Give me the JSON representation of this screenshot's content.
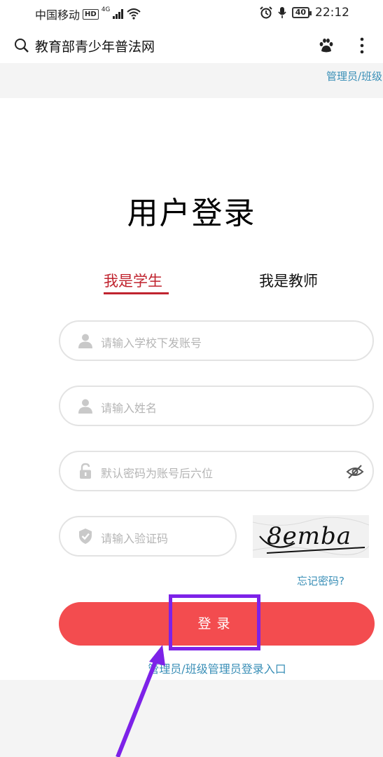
{
  "status_bar": {
    "carrier": "中国移动",
    "hd_badge": "HD",
    "network": "4G",
    "battery": "40",
    "time": "22:12"
  },
  "browser": {
    "title": "教育部青少年普法网"
  },
  "page": {
    "top_link": "管理员/班级",
    "heading": "用户登录",
    "tabs": [
      {
        "label": "我是学生",
        "active": true
      },
      {
        "label": "我是教师",
        "active": false
      }
    ],
    "fields": {
      "account_placeholder": "请输入学校下发账号",
      "name_placeholder": "请输入姓名",
      "password_placeholder": "默认密码为账号后六位",
      "captcha_placeholder": "请输入验证码"
    },
    "captcha_text": "8emba",
    "forgot_password": "忘记密码?",
    "login_button": "登录",
    "admin_entry": "管理员/班级管理员登录入口"
  },
  "colors": {
    "accent_red": "#c0242f",
    "button_red": "#f34c4f",
    "link_blue": "#3a8fb7",
    "annotation_purple": "#7d22e8"
  }
}
